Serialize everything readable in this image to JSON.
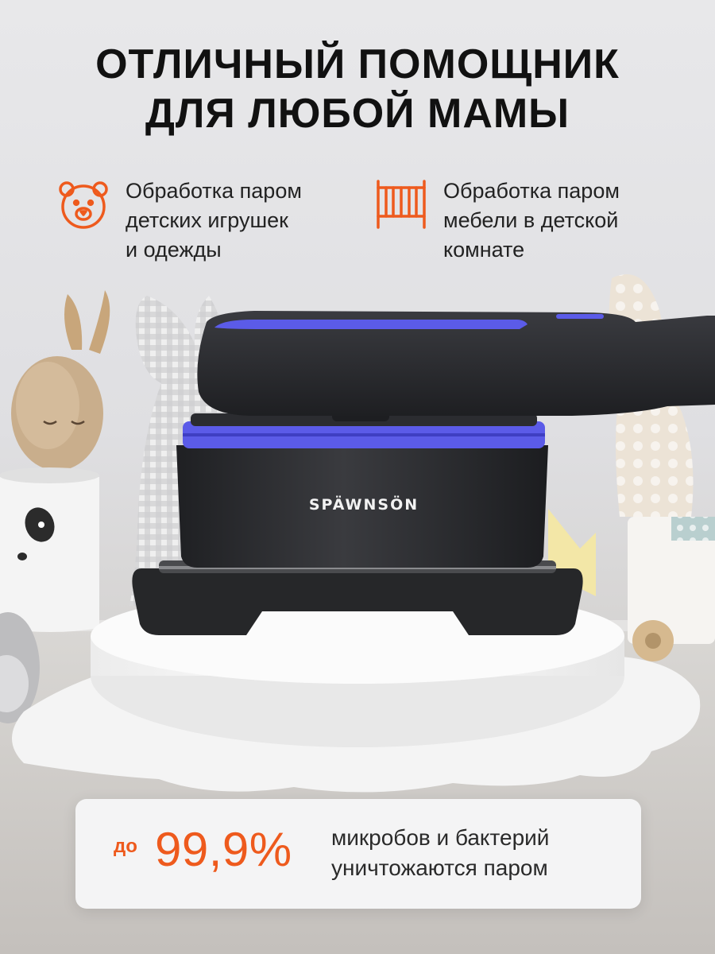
{
  "headline": {
    "line1": "ОТЛИЧНЫЙ ПОМОЩНИК",
    "line2": "ДЛЯ ЛЮБОЙ МАМЫ"
  },
  "features": [
    {
      "icon": "teddy-bear-icon",
      "lines": [
        "Обработка паром",
        "детских игрушек",
        "и одежды"
      ]
    },
    {
      "icon": "crib-icon",
      "lines": [
        "Обработка паром",
        "мебели в детской",
        "комнате"
      ]
    }
  ],
  "product": {
    "brand": "SPÄWNSÖN"
  },
  "stat": {
    "prefix": "до",
    "value": "99,9%",
    "desc_line1": "микробов и бактерий",
    "desc_line2": "уничтожаются паром"
  },
  "colors": {
    "accent": "#EE5A1D",
    "device_body": "#2B2C2F",
    "device_ring": "#5B5BE8"
  }
}
